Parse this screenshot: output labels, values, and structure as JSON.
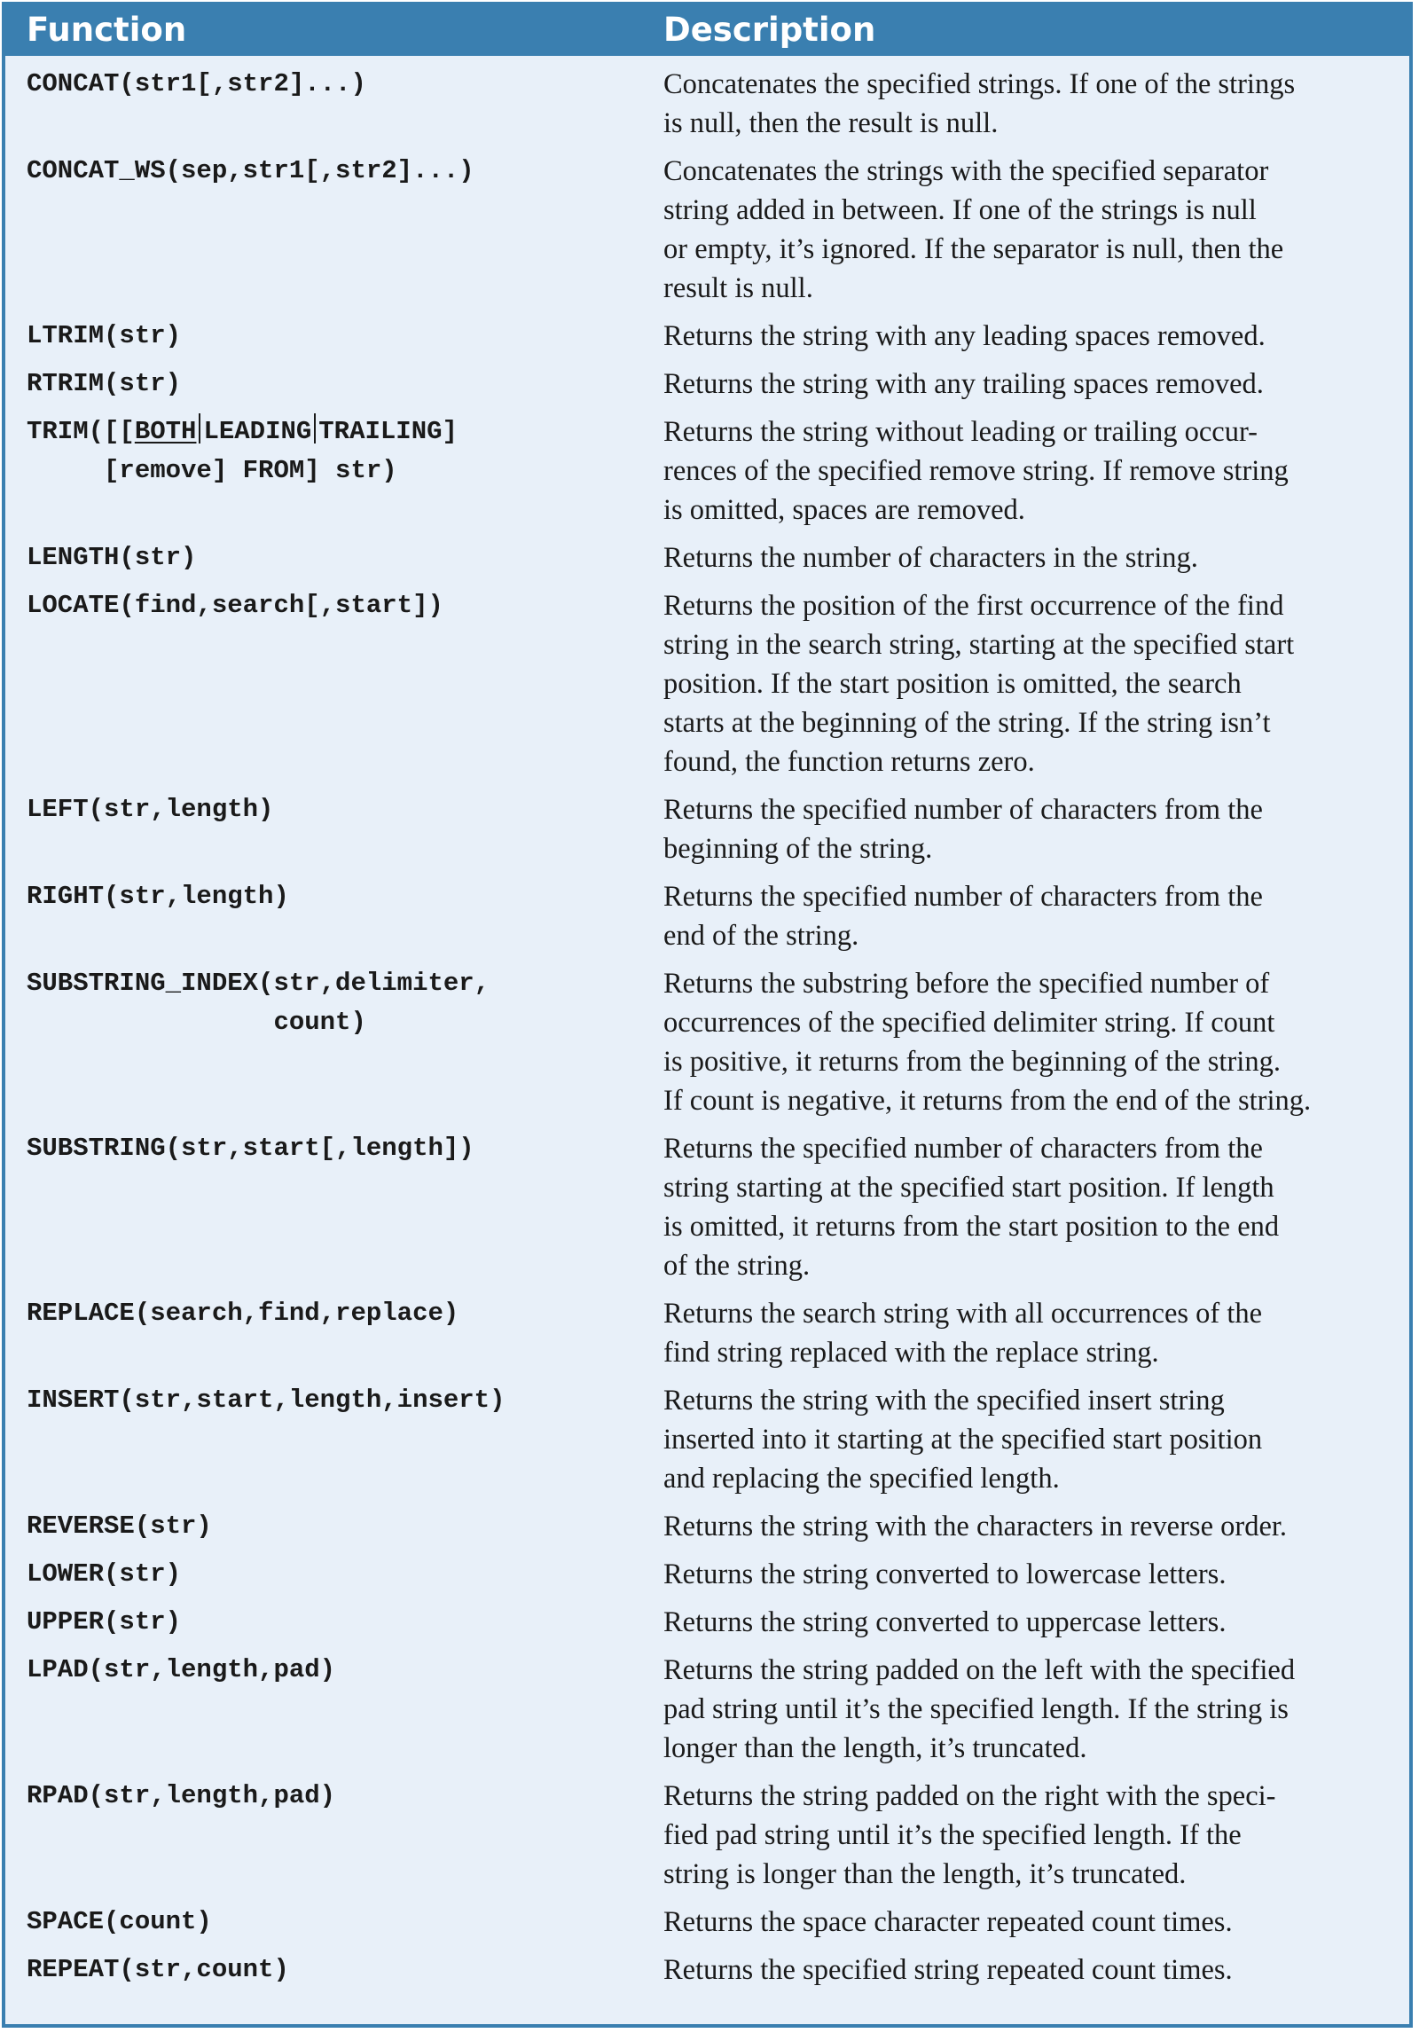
{
  "header": {
    "function_label": "Function",
    "description_label": "Description"
  },
  "rows": [
    {
      "fn_lines": [
        "CONCAT(str1[,str2]...)"
      ],
      "desc_lines": [
        "Concatenates the specified strings. If one of the strings",
        "is null, then the result is null."
      ]
    },
    {
      "fn_lines": [
        "CONCAT_WS(sep,str1[,str2]...)"
      ],
      "desc_lines": [
        "Concatenates the strings with the specified separator",
        "string added in between. If one of the strings is null",
        "or empty, it’s ignored. If the separator is null, then the",
        "result is null."
      ]
    },
    {
      "fn_lines": [
        "LTRIM(str)"
      ],
      "desc_lines": [
        "Returns the string with any leading spaces removed."
      ]
    },
    {
      "fn_lines": [
        "RTRIM(str)"
      ],
      "desc_lines": [
        "Returns the string with any trailing spaces removed."
      ]
    },
    {
      "fn_trim": {
        "prefix": "TRIM([[",
        "both": "BOTH",
        "leading": "LEADING",
        "trailing": "TRAILING]",
        "line2": "     [remove] FROM] str)"
      },
      "desc_lines": [
        "Returns the string without leading or trailing occur-",
        "rences of the specified remove string. If remove string",
        "is omitted, spaces are removed."
      ]
    },
    {
      "fn_lines": [
        "LENGTH(str)"
      ],
      "desc_lines": [
        "Returns the number of characters in the string."
      ]
    },
    {
      "fn_lines": [
        "LOCATE(find,search[,start])"
      ],
      "desc_lines": [
        "Returns the position of the first occurrence of the find",
        "string in the search string, starting at the specified start",
        "position. If the start position is omitted, the search",
        "starts at the beginning of the string. If the string isn’t",
        "found, the function returns zero."
      ]
    },
    {
      "fn_lines": [
        "LEFT(str,length)"
      ],
      "desc_lines": [
        "Returns the specified number of characters from the",
        "beginning of the string."
      ]
    },
    {
      "fn_lines": [
        "RIGHT(str,length)"
      ],
      "desc_lines": [
        "Returns the specified number of characters from the",
        "end of the string."
      ]
    },
    {
      "fn_lines": [
        "SUBSTRING_INDEX(str,delimiter,",
        "                count)"
      ],
      "desc_lines": [
        "Returns the substring before the specified number of",
        "occurrences of the specified delimiter string. If count",
        "is positive, it returns from the beginning of the string.",
        "If count is negative, it returns from the end of the string."
      ]
    },
    {
      "fn_lines": [
        "SUBSTRING(str,start[,length])"
      ],
      "desc_lines": [
        "Returns the specified number of characters from the",
        "string starting at the specified start position. If length",
        "is omitted, it returns from the start position to the end",
        "of the string."
      ]
    },
    {
      "fn_lines": [
        "REPLACE(search,find,replace)"
      ],
      "desc_lines": [
        "Returns the search string with all occurrences of the",
        "find string replaced with the replace string."
      ]
    },
    {
      "fn_lines": [
        "INSERT(str,start,length,insert)"
      ],
      "desc_lines": [
        "Returns the string with the specified insert string",
        "inserted into it starting at the specified start position",
        "and replacing the specified length."
      ]
    },
    {
      "fn_lines": [
        "REVERSE(str)"
      ],
      "desc_lines": [
        "Returns the string with the characters in reverse order."
      ]
    },
    {
      "fn_lines": [
        "LOWER(str)"
      ],
      "desc_lines": [
        "Returns the string converted to lowercase letters."
      ]
    },
    {
      "fn_lines": [
        "UPPER(str)"
      ],
      "desc_lines": [
        "Returns the string converted to uppercase letters."
      ]
    },
    {
      "fn_lines": [
        "LPAD(str,length,pad)"
      ],
      "desc_lines": [
        "Returns the string padded on the left with the specified",
        "pad string until it’s the specified length. If the string is",
        "longer than the length, it’s truncated."
      ]
    },
    {
      "fn_lines": [
        "RPAD(str,length,pad)"
      ],
      "desc_lines": [
        "Returns the string padded on the right with the speci-",
        "fied pad string until it’s the specified length. If the",
        "string is longer than the length, it’s truncated."
      ]
    },
    {
      "fn_lines": [
        "SPACE(count)"
      ],
      "desc_lines": [
        "Returns the space character repeated count times."
      ]
    },
    {
      "fn_lines": [
        "REPEAT(str,count)"
      ],
      "desc_lines": [
        "Returns the specified string repeated count times."
      ]
    }
  ]
}
